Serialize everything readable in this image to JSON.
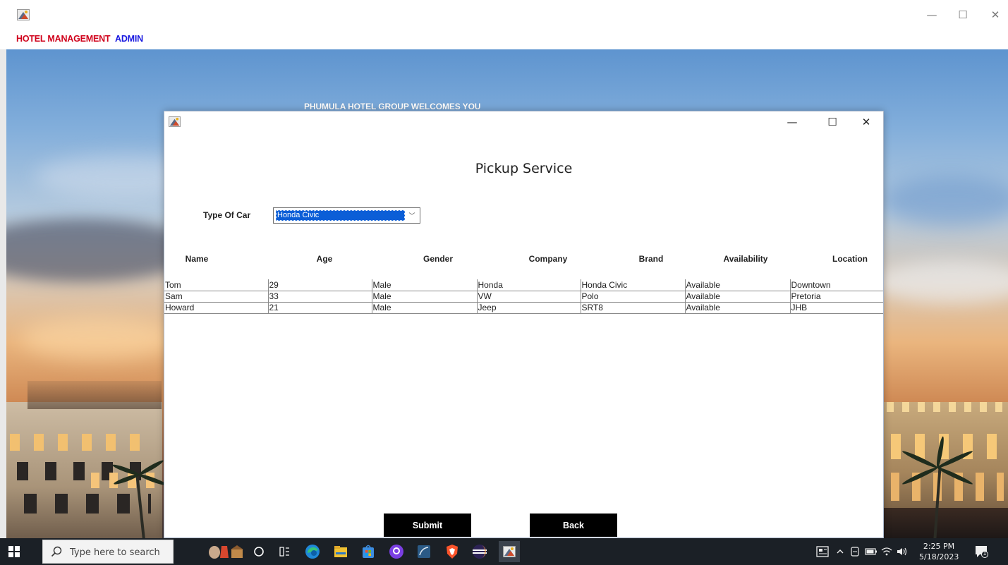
{
  "main_window": {
    "menu": [
      "HOTEL MANAGEMENT",
      "ADMIN"
    ],
    "controls": {
      "minimize": "—",
      "maximize": "☐",
      "close": "✕"
    }
  },
  "background": {
    "welcome_text": "PHUMULA HOTEL GROUP WELCOMES YOU"
  },
  "dialog": {
    "controls": {
      "minimize": "—",
      "maximize": "☐",
      "close": "✕"
    },
    "heading": "Pickup Service",
    "type_of_car_label": "Type Of Car",
    "type_of_car_selected": "Honda Civic",
    "dropdown_arrow": "﹀",
    "columns": [
      "Name",
      "Age",
      "Gender",
      "Company",
      "Brand",
      "Availability",
      "Location"
    ],
    "rows": [
      [
        "Tom",
        "29",
        "Male",
        "Honda",
        "Honda Civic",
        "Available",
        "Downtown"
      ],
      [
        "Sam",
        "33",
        "Male",
        "VW",
        "Polo",
        "Available",
        "Pretoria"
      ],
      [
        "Howard",
        "21",
        "Male",
        "Jeep",
        "SRT8",
        "Available",
        "JHB"
      ]
    ],
    "submit_label": "Submit",
    "back_label": "Back"
  },
  "taskbar": {
    "search_placeholder": "Type here to search",
    "time": "2:25 PM",
    "date": "5/18/2023",
    "notification_count": "1",
    "colors": {
      "bar": "#1b2026",
      "accent_red": "#d0021b",
      "accent_blue": "#1a1ae0"
    }
  }
}
